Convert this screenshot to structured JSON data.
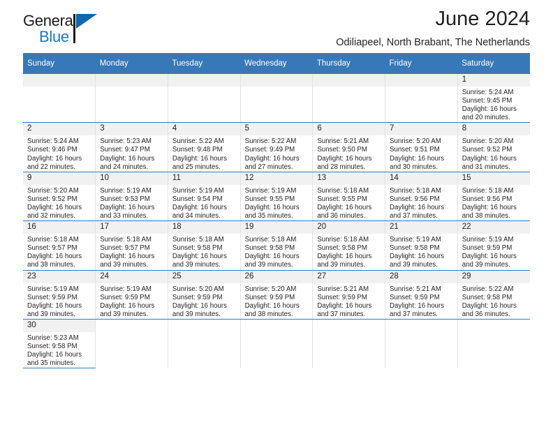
{
  "logo": {
    "name_top": "General",
    "name_bottom": "Blue",
    "triangle_color": "#1266ad",
    "blue_color": "#1878c4"
  },
  "header": {
    "title": "June 2024",
    "subtitle": "Odiliapeel, North Brabant, The Netherlands",
    "header_bg": "#3778b8"
  },
  "weekdays": [
    "Sunday",
    "Monday",
    "Tuesday",
    "Wednesday",
    "Thursday",
    "Friday",
    "Saturday"
  ],
  "labels": {
    "sunrise_prefix": "Sunrise:",
    "sunset_prefix": "Sunset:",
    "daylight_prefix": "Daylight:"
  },
  "weeks": [
    [
      {
        "day": "",
        "blank": true
      },
      {
        "day": "",
        "blank": true
      },
      {
        "day": "",
        "blank": true
      },
      {
        "day": "",
        "blank": true
      },
      {
        "day": "",
        "blank": true
      },
      {
        "day": "",
        "blank": true
      },
      {
        "day": "1",
        "sunrise": "Sunrise: 5:24 AM",
        "sunset": "Sunset: 9:45 PM",
        "daylight1": "Daylight: 16 hours",
        "daylight2": "and 20 minutes."
      }
    ],
    [
      {
        "day": "2",
        "sunrise": "Sunrise: 5:24 AM",
        "sunset": "Sunset: 9:46 PM",
        "daylight1": "Daylight: 16 hours",
        "daylight2": "and 22 minutes."
      },
      {
        "day": "3",
        "sunrise": "Sunrise: 5:23 AM",
        "sunset": "Sunset: 9:47 PM",
        "daylight1": "Daylight: 16 hours",
        "daylight2": "and 24 minutes."
      },
      {
        "day": "4",
        "sunrise": "Sunrise: 5:22 AM",
        "sunset": "Sunset: 9:48 PM",
        "daylight1": "Daylight: 16 hours",
        "daylight2": "and 25 minutes."
      },
      {
        "day": "5",
        "sunrise": "Sunrise: 5:22 AM",
        "sunset": "Sunset: 9:49 PM",
        "daylight1": "Daylight: 16 hours",
        "daylight2": "and 27 minutes."
      },
      {
        "day": "6",
        "sunrise": "Sunrise: 5:21 AM",
        "sunset": "Sunset: 9:50 PM",
        "daylight1": "Daylight: 16 hours",
        "daylight2": "and 28 minutes."
      },
      {
        "day": "7",
        "sunrise": "Sunrise: 5:20 AM",
        "sunset": "Sunset: 9:51 PM",
        "daylight1": "Daylight: 16 hours",
        "daylight2": "and 30 minutes."
      },
      {
        "day": "8",
        "sunrise": "Sunrise: 5:20 AM",
        "sunset": "Sunset: 9:52 PM",
        "daylight1": "Daylight: 16 hours",
        "daylight2": "and 31 minutes."
      }
    ],
    [
      {
        "day": "9",
        "sunrise": "Sunrise: 5:20 AM",
        "sunset": "Sunset: 9:52 PM",
        "daylight1": "Daylight: 16 hours",
        "daylight2": "and 32 minutes."
      },
      {
        "day": "10",
        "sunrise": "Sunrise: 5:19 AM",
        "sunset": "Sunset: 9:53 PM",
        "daylight1": "Daylight: 16 hours",
        "daylight2": "and 33 minutes."
      },
      {
        "day": "11",
        "sunrise": "Sunrise: 5:19 AM",
        "sunset": "Sunset: 9:54 PM",
        "daylight1": "Daylight: 16 hours",
        "daylight2": "and 34 minutes."
      },
      {
        "day": "12",
        "sunrise": "Sunrise: 5:19 AM",
        "sunset": "Sunset: 9:55 PM",
        "daylight1": "Daylight: 16 hours",
        "daylight2": "and 35 minutes."
      },
      {
        "day": "13",
        "sunrise": "Sunrise: 5:18 AM",
        "sunset": "Sunset: 9:55 PM",
        "daylight1": "Daylight: 16 hours",
        "daylight2": "and 36 minutes."
      },
      {
        "day": "14",
        "sunrise": "Sunrise: 5:18 AM",
        "sunset": "Sunset: 9:56 PM",
        "daylight1": "Daylight: 16 hours",
        "daylight2": "and 37 minutes."
      },
      {
        "day": "15",
        "sunrise": "Sunrise: 5:18 AM",
        "sunset": "Sunset: 9:56 PM",
        "daylight1": "Daylight: 16 hours",
        "daylight2": "and 38 minutes."
      }
    ],
    [
      {
        "day": "16",
        "sunrise": "Sunrise: 5:18 AM",
        "sunset": "Sunset: 9:57 PM",
        "daylight1": "Daylight: 16 hours",
        "daylight2": "and 38 minutes."
      },
      {
        "day": "17",
        "sunrise": "Sunrise: 5:18 AM",
        "sunset": "Sunset: 9:57 PM",
        "daylight1": "Daylight: 16 hours",
        "daylight2": "and 39 minutes."
      },
      {
        "day": "18",
        "sunrise": "Sunrise: 5:18 AM",
        "sunset": "Sunset: 9:58 PM",
        "daylight1": "Daylight: 16 hours",
        "daylight2": "and 39 minutes."
      },
      {
        "day": "19",
        "sunrise": "Sunrise: 5:18 AM",
        "sunset": "Sunset: 9:58 PM",
        "daylight1": "Daylight: 16 hours",
        "daylight2": "and 39 minutes."
      },
      {
        "day": "20",
        "sunrise": "Sunrise: 5:18 AM",
        "sunset": "Sunset: 9:58 PM",
        "daylight1": "Daylight: 16 hours",
        "daylight2": "and 39 minutes."
      },
      {
        "day": "21",
        "sunrise": "Sunrise: 5:19 AM",
        "sunset": "Sunset: 9:58 PM",
        "daylight1": "Daylight: 16 hours",
        "daylight2": "and 39 minutes."
      },
      {
        "day": "22",
        "sunrise": "Sunrise: 5:19 AM",
        "sunset": "Sunset: 9:59 PM",
        "daylight1": "Daylight: 16 hours",
        "daylight2": "and 39 minutes."
      }
    ],
    [
      {
        "day": "23",
        "sunrise": "Sunrise: 5:19 AM",
        "sunset": "Sunset: 9:59 PM",
        "daylight1": "Daylight: 16 hours",
        "daylight2": "and 39 minutes."
      },
      {
        "day": "24",
        "sunrise": "Sunrise: 5:19 AM",
        "sunset": "Sunset: 9:59 PM",
        "daylight1": "Daylight: 16 hours",
        "daylight2": "and 39 minutes."
      },
      {
        "day": "25",
        "sunrise": "Sunrise: 5:20 AM",
        "sunset": "Sunset: 9:59 PM",
        "daylight1": "Daylight: 16 hours",
        "daylight2": "and 39 minutes."
      },
      {
        "day": "26",
        "sunrise": "Sunrise: 5:20 AM",
        "sunset": "Sunset: 9:59 PM",
        "daylight1": "Daylight: 16 hours",
        "daylight2": "and 38 minutes."
      },
      {
        "day": "27",
        "sunrise": "Sunrise: 5:21 AM",
        "sunset": "Sunset: 9:59 PM",
        "daylight1": "Daylight: 16 hours",
        "daylight2": "and 37 minutes."
      },
      {
        "day": "28",
        "sunrise": "Sunrise: 5:21 AM",
        "sunset": "Sunset: 9:59 PM",
        "daylight1": "Daylight: 16 hours",
        "daylight2": "and 37 minutes."
      },
      {
        "day": "29",
        "sunrise": "Sunrise: 5:22 AM",
        "sunset": "Sunset: 9:58 PM",
        "daylight1": "Daylight: 16 hours",
        "daylight2": "and 36 minutes."
      }
    ],
    [
      {
        "day": "30",
        "sunrise": "Sunrise: 5:23 AM",
        "sunset": "Sunset: 9:58 PM",
        "daylight1": "Daylight: 16 hours",
        "daylight2": "and 35 minutes."
      },
      {
        "day": "",
        "out": true
      },
      {
        "day": "",
        "out": true
      },
      {
        "day": "",
        "out": true
      },
      {
        "day": "",
        "out": true
      },
      {
        "day": "",
        "out": true
      },
      {
        "day": "",
        "out": true
      }
    ]
  ]
}
